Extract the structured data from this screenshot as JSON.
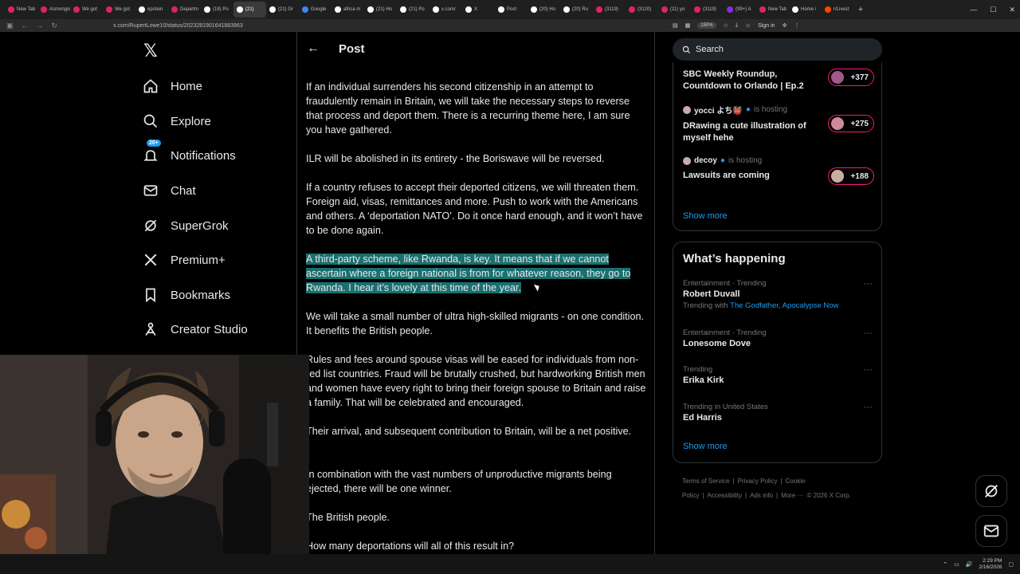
{
  "browser": {
    "tabs": [
      {
        "label": "New Tab",
        "color": "#e0245e"
      },
      {
        "label": "Asmongold",
        "color": "#e0245e"
      },
      {
        "label": "We got",
        "color": "#e0245e"
      },
      {
        "label": "We got",
        "color": "#e0245e"
      },
      {
        "label": "epstein",
        "color": "#ffffff"
      },
      {
        "label": "Departm",
        "color": "#e0245e"
      },
      {
        "label": "(18) Po",
        "color": "#ffffff"
      },
      {
        "label": "(21)",
        "color": "#ffffff",
        "active": true
      },
      {
        "label": "(21) Gr",
        "color": "#ffffff"
      },
      {
        "label": "Google",
        "color": "#4285f4"
      },
      {
        "label": "africa m",
        "color": "#ffffff"
      },
      {
        "label": "(21) Ho",
        "color": "#ffffff"
      },
      {
        "label": "(21) Po",
        "color": "#ffffff"
      },
      {
        "label": "x.com/",
        "color": "#ffffff"
      },
      {
        "label": "X",
        "color": "#ffffff"
      },
      {
        "label": "Post",
        "color": "#ffffff"
      },
      {
        "label": "(20) Ho",
        "color": "#ffffff"
      },
      {
        "label": "(20) Ru",
        "color": "#ffffff"
      },
      {
        "label": "(3119)",
        "color": "#e0245e"
      },
      {
        "label": "(3120)",
        "color": "#e0245e"
      },
      {
        "label": "(11) yo",
        "color": "#e0245e"
      },
      {
        "label": "(3119)",
        "color": "#e0245e"
      },
      {
        "label": "(99+) A",
        "color": "#8a2be2"
      },
      {
        "label": "New Tab",
        "color": "#e0245e"
      },
      {
        "label": "Home /",
        "color": "#ffffff"
      },
      {
        "label": "r/Livest",
        "color": "#ff4500"
      }
    ],
    "url": "x.com/RupertLowe10/status/2023281901641883963",
    "zoom": "150%",
    "sign_in": "Sign in"
  },
  "sidebar": {
    "items": [
      {
        "label": "Home",
        "icon": "home-icon"
      },
      {
        "label": "Explore",
        "icon": "search-icon"
      },
      {
        "label": "Notifications",
        "icon": "bell-icon",
        "badge": "20+"
      },
      {
        "label": "Chat",
        "icon": "mail-icon"
      },
      {
        "label": "SuperGrok",
        "icon": "grok-icon"
      },
      {
        "label": "Premium+",
        "icon": "x-icon"
      },
      {
        "label": "Bookmarks",
        "icon": "bookmark-icon"
      },
      {
        "label": "Creator Studio",
        "icon": "creator-icon"
      }
    ]
  },
  "post": {
    "header_title": "Post",
    "paragraphs": [
      {
        "text": "If an individual surrenders his second citizenship in an attempt to fraudulently remain in Britain, we will take the necessary steps to reverse that process and deport them. There is a recurring theme here, I am sure you have gathered."
      },
      {
        "text": "ILR will be abolished in its entirety - the Boriswave will be reversed."
      },
      {
        "text": "If a country refuses to accept their deported citizens, we will threaten them. Foreign aid, visas, remittances and more. Push to work with the Americans and others. A ‘deportation NATO’. Do it once hard enough, and it won’t have to be done again."
      },
      {
        "text": "A third-party scheme, like Rwanda, is key. It means that if we cannot ascertain where a foreign national is from for whatever reason, they go to Rwanda. I hear it’s lovely at this time of the year.",
        "highlighted": true
      },
      {
        "text": "We will take a small number of ultra high-skilled migrants - on one condition. It benefits the British people."
      },
      {
        "text": "Rules and fees around spouse visas will be eased for individuals from non-red list countries. Fraud will be brutally crushed, but hardworking British men and women have every right to bring their foreign spouse to Britain and raise a family. That will be celebrated and encouraged."
      },
      {
        "text": "Their arrival, and subsequent contribution to Britain, will be a net positive."
      },
      {
        "text": "In combination with the vast numbers of unproductive migrants being ejected, there will be one winner."
      },
      {
        "text": "The British people."
      },
      {
        "text": "How many deportations will all of this result in?"
      }
    ]
  },
  "right": {
    "search_placeholder": "Search",
    "spaces": [
      {
        "host": "",
        "host_suffix": "",
        "title": "SBC Weekly Roundup, Countdown to Orlando | Ep.2",
        "count": "+377"
      },
      {
        "host": "yocci よち👹",
        "host_suffix": "is hosting",
        "title": "DRawing a cute illustration of myself hehe",
        "count": "+275"
      },
      {
        "host": "decoy",
        "host_suffix": "is hosting",
        "title": "Lawsuits are coming",
        "count": "+188"
      }
    ],
    "spaces_show_more": "Show more",
    "happening_title": "What’s happening",
    "trends": [
      {
        "meta": "Entertainment · Trending",
        "name": "Robert Duvall",
        "with_label": "Trending with",
        "with_links": "The Godfather, Apocalypse Now"
      },
      {
        "meta": "Entertainment · Trending",
        "name": "Lonesome Dove"
      },
      {
        "meta": "Trending",
        "name": "Erika Kirk"
      },
      {
        "meta": "Trending in United States",
        "name": "Ed Harris"
      }
    ],
    "trends_show_more": "Show more",
    "footer": [
      "Terms of Service",
      "|",
      "Privacy Policy",
      "|",
      "Cookie Policy",
      "|",
      "Accessibility",
      "|",
      "Ads info",
      "|",
      "More ···",
      "© 2026 X Corp."
    ]
  },
  "taskbar": {
    "time": "2:29 PM",
    "date": "2/16/2026"
  }
}
